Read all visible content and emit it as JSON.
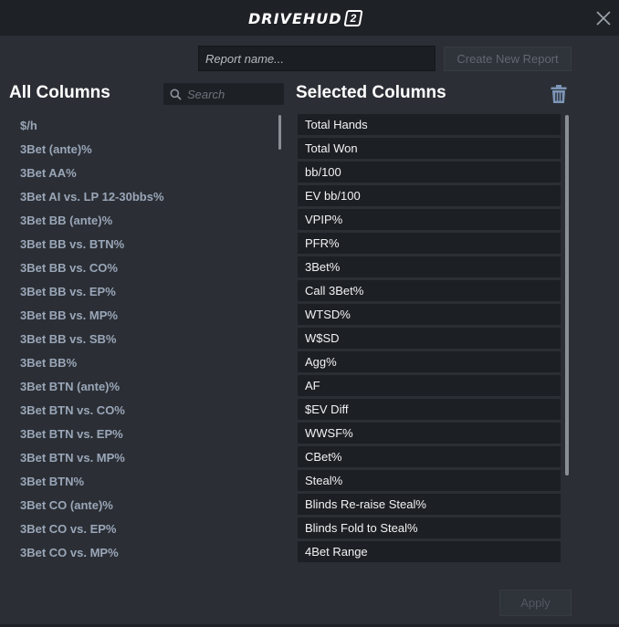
{
  "window": {
    "logo_text": "DRIVEHUD",
    "logo_badge": "2"
  },
  "toolbar": {
    "report_name_placeholder": "Report name...",
    "create_button_label": "Create New Report"
  },
  "all_columns": {
    "title": "All Columns",
    "search_placeholder": "Search",
    "items": [
      "$/h",
      "3Bet (ante)%",
      "3Bet AA%",
      "3Bet AI vs. LP 12-30bbs%",
      "3Bet BB (ante)%",
      "3Bet BB vs. BTN%",
      "3Bet BB vs. CO%",
      "3Bet BB vs. EP%",
      "3Bet BB vs. MP%",
      "3Bet BB vs. SB%",
      "3Bet BB%",
      "3Bet BTN (ante)%",
      "3Bet BTN vs. CO%",
      "3Bet BTN vs. EP%",
      "3Bet BTN vs. MP%",
      "3Bet BTN%",
      "3Bet CO (ante)%",
      "3Bet CO vs. EP%",
      "3Bet CO vs. MP%"
    ]
  },
  "selected_columns": {
    "title": "Selected Columns",
    "items": [
      "Total Hands",
      "Total Won",
      "bb/100",
      "EV bb/100",
      "VPIP%",
      "PFR%",
      "3Bet%",
      "Call 3Bet%",
      "WTSD%",
      "W$SD",
      "Agg%",
      "AF",
      "$EV Diff",
      "WWSF%",
      "CBet%",
      "Steal%",
      "Blinds Re-raise Steal%",
      "Blinds Fold to Steal%",
      "4Bet Range"
    ]
  },
  "footer": {
    "apply_label": "Apply"
  },
  "colors": {
    "background": "#2b2f35",
    "titlebar": "#1e2126",
    "list_text": "#9aa6b8",
    "selected_item_bg": "#1c1f23"
  }
}
